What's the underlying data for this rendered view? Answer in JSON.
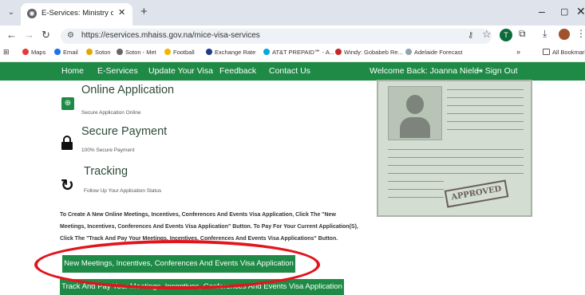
{
  "browser": {
    "tab_title": "E-Services: Ministry of Home Af",
    "tab_close": "✕",
    "new_tab": "+",
    "url": "https://eservices.mhaiss.gov.na/mice-visa-services",
    "bookmarks": [
      "Maps",
      "Email",
      "Soton",
      "Soton - Met",
      "Football",
      "Exchange Rate",
      "AT&T PREPAID℠ - A...",
      "Windy: Gobabeb Re...",
      "Adelaide Forecast"
    ],
    "bookmarks_more": "»",
    "all_bookmarks": "All Bookmarks",
    "extension_badge": "T"
  },
  "nav": {
    "items": [
      "Home",
      "E-Services",
      "Update Your Visa",
      "Feedback",
      "Contact Us"
    ],
    "welcome": "Welcome Back: Joanna Nield",
    "sign_out": "Sign Out"
  },
  "features": [
    {
      "title": "Online Application",
      "subtitle": "Secure Application Online",
      "icon": "passport-icon"
    },
    {
      "title": "Secure Payment",
      "subtitle": "100% Secure Payment",
      "icon": "lock-icon"
    },
    {
      "title": "Tracking",
      "subtitle": "Follow Up Your Application Status",
      "icon": "refresh-icon"
    }
  ],
  "instructions": {
    "line1": "To Create A New Online Meetings, Incentives, Conferences And Events Visa Application, Click The \"New",
    "line2": "Meetings, Incentives, Conferences And Events Visa Application\" Button. To Pay For Your Current Application(S),",
    "line3": "Click The \"Track And Pay Your Meetings, Incentives, Conferences And Events Visa Applications\" Button."
  },
  "buttons": {
    "new_application": "New Meetings, Incentives, Conferences And Events Visa Application",
    "track_and_pay": "Track And Pay Your Meetings, Incentives, Conferences And Events Visa Application"
  },
  "visa_card": {
    "stamp": "APPROVED"
  },
  "colors": {
    "nav_green": "#1e8a45",
    "highlight_red": "#e3141c"
  }
}
